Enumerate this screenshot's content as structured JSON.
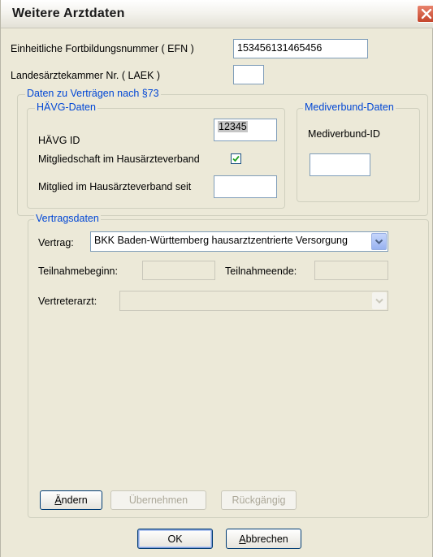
{
  "window": {
    "title": "Weitere Arztdaten"
  },
  "efn": {
    "label": "Einheitliche Fortbildungsnummer ( EFN )",
    "value": "153456131465456"
  },
  "laek": {
    "label": "Landesärztekammer Nr. ( LAEK )",
    "value": ""
  },
  "contracts_group": {
    "legend": "Daten zu Verträgen nach §73"
  },
  "haevg": {
    "legend": "HÄVG-Daten",
    "id_label": "HÄVG ID",
    "id_value": "12345",
    "membership_label": "Mitgliedschaft im Hausärzteverband",
    "membership_checked": true,
    "member_since_label": "Mitglied im Hausärzteverband seit",
    "member_since_value": ""
  },
  "mediverbund": {
    "legend": "Mediverbund-Daten",
    "id_label": "Mediverbund-ID",
    "id_value": ""
  },
  "vertragsdaten": {
    "legend": "Vertragsdaten",
    "vertrag_label": "Vertrag:",
    "vertrag_value": "BKK Baden-Württemberg hausarztzentrierte Versorgung",
    "teilnahmebeginn_label": "Teilnahmebeginn:",
    "teilnahmebeginn_value": "",
    "teilnahmeende_label": "Teilnahmeende:",
    "teilnahmeende_value": "",
    "vertreterarzt_label": "Vertreterarzt:",
    "vertreterarzt_value": ""
  },
  "action_buttons": {
    "aendern_first": "Ä",
    "aendern_rest": "ndern",
    "uebernehmen": "Übernehmen",
    "rueckgaengig": "Rückgängig"
  },
  "dialog_buttons": {
    "ok": "OK",
    "abbrechen_first": "A",
    "abbrechen_rest": "bbrechen"
  },
  "colors": {
    "window_bg": "#ece9d8",
    "legend_text": "#0046d5",
    "close_button": "#c4452b",
    "input_border": "#7f9db9"
  }
}
